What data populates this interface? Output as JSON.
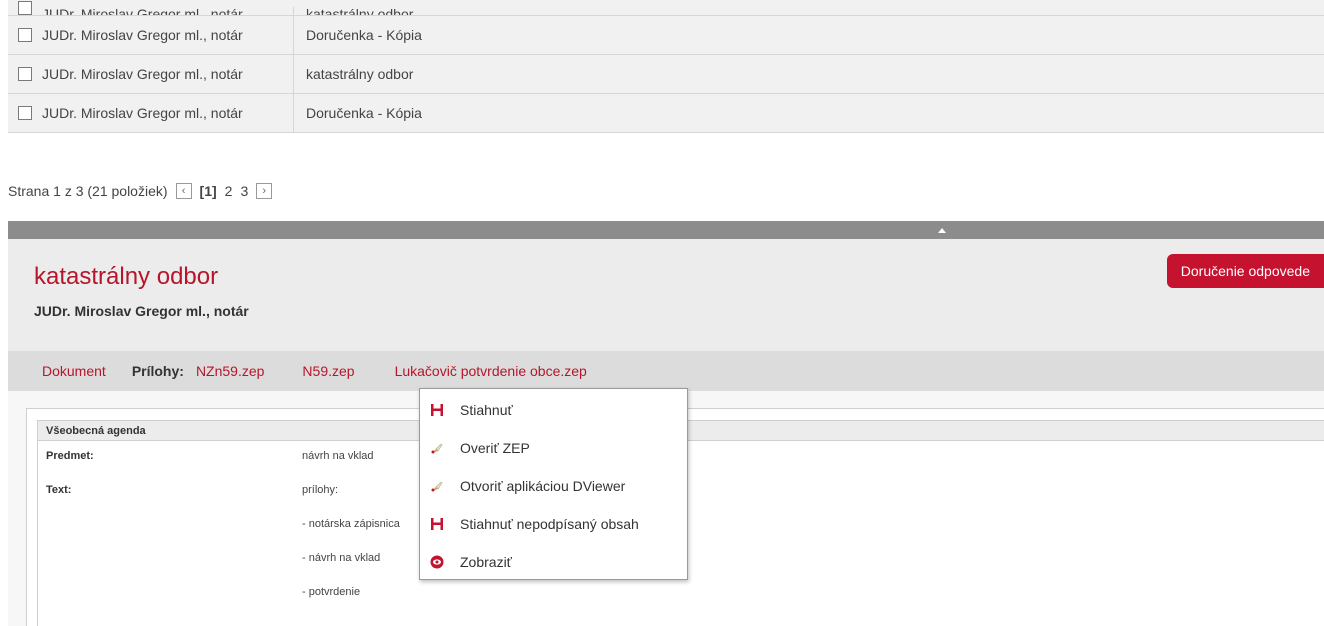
{
  "list": {
    "rows": [
      {
        "sender": "JUDr. Miroslav Gregor ml., notár",
        "subject": "katastrálny odbor"
      },
      {
        "sender": "JUDr. Miroslav Gregor ml., notár",
        "subject": "Doručenka - Kópia"
      },
      {
        "sender": "JUDr. Miroslav Gregor ml., notár",
        "subject": "katastrálny odbor"
      },
      {
        "sender": "JUDr. Miroslav Gregor ml., notár",
        "subject": "Doručenka - Kópia"
      }
    ]
  },
  "pager": {
    "summary": "Strana 1 z 3 (21 položiek)",
    "prev_icon": "chevron-left-icon",
    "next_icon": "chevron-right-icon",
    "pages": [
      "[1]",
      "2",
      "3"
    ]
  },
  "detail": {
    "title": "katastrálny odbor",
    "sender": "JUDr. Miroslav Gregor ml., notár",
    "reply_button": "Doručenie odpovede"
  },
  "tabs": {
    "document": "Dokument",
    "attachments_label": "Prílohy:",
    "attachments": [
      "NZn59.zep",
      "N59.zep",
      "Lukačovič potvrdenie obce.zep"
    ]
  },
  "document": {
    "section": "Všeobecná agenda",
    "subject_label": "Predmet:",
    "subject_value": "návrh na vklad",
    "text_label": "Text:",
    "text_lines": [
      "prílohy:",
      "- notárska zápisnica",
      "- návrh na vklad",
      "- potvrdenie"
    ]
  },
  "context_menu": {
    "items": [
      {
        "label": "Stiahnuť",
        "icon": "save-icon"
      },
      {
        "label": "Overiť ZEP",
        "icon": "verify-icon"
      },
      {
        "label": "Otvoriť aplikáciou DViewer",
        "icon": "open-app-icon"
      },
      {
        "label": "Stiahnuť nepodpísaný obsah",
        "icon": "save-icon"
      },
      {
        "label": "Zobraziť",
        "icon": "eye-icon"
      }
    ]
  },
  "colors": {
    "accent": "#c4122f",
    "link": "#b5162b"
  }
}
